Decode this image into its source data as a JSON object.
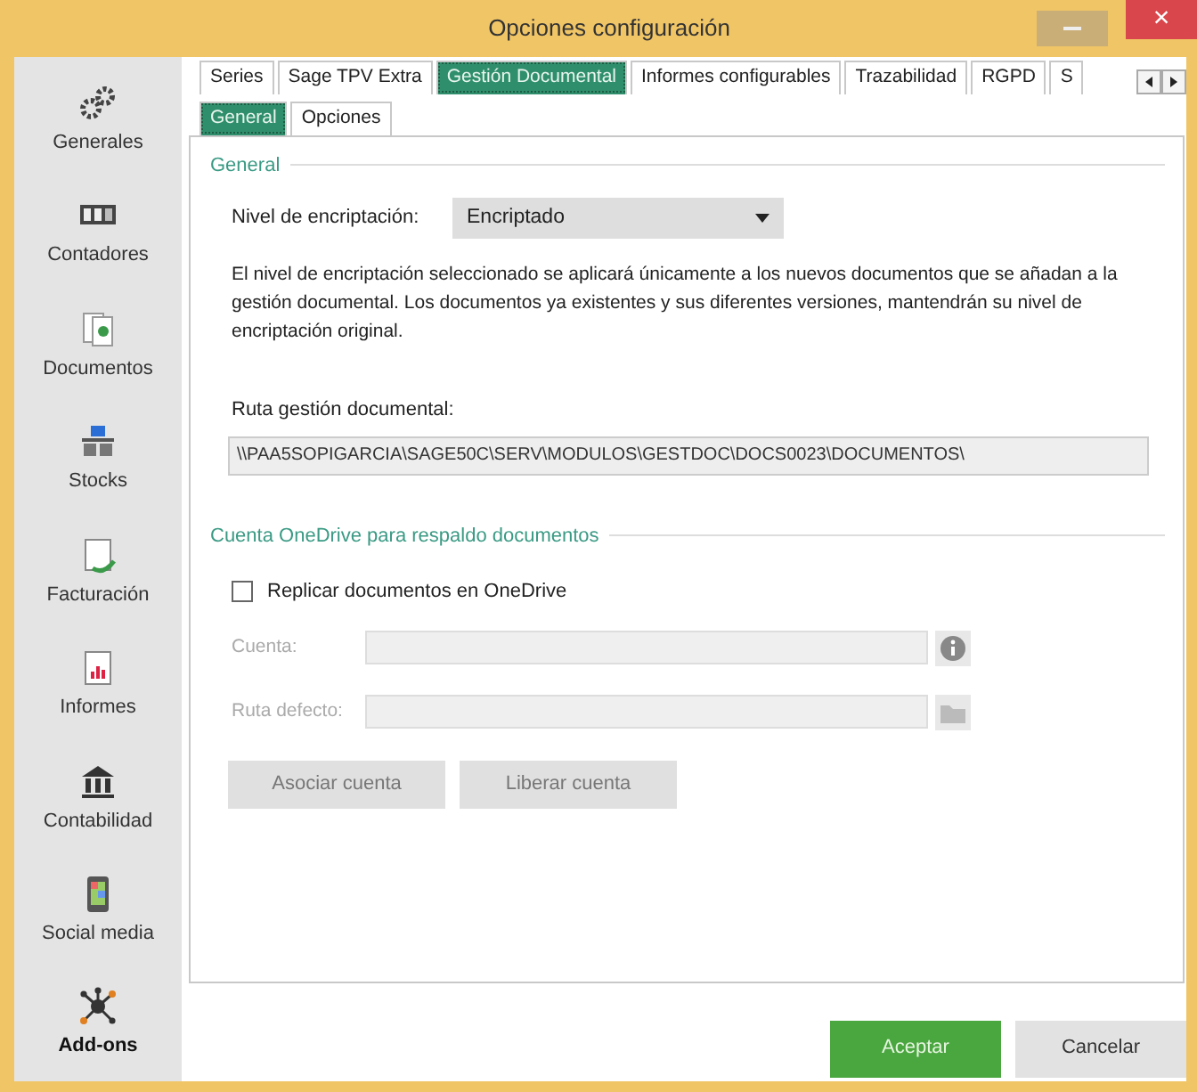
{
  "window": {
    "title": "Opciones configuración",
    "close": "×"
  },
  "sidebar": {
    "items": [
      {
        "kind": "gears",
        "label": "Generales",
        "selected": false
      },
      {
        "kind": "counter",
        "label": "Contadores",
        "selected": false
      },
      {
        "kind": "documents",
        "label": "Documentos",
        "selected": false
      },
      {
        "kind": "stocks",
        "label": "Stocks",
        "selected": false
      },
      {
        "kind": "invoice",
        "label": "Facturación",
        "selected": false
      },
      {
        "kind": "report",
        "label": "Informes",
        "selected": false
      },
      {
        "kind": "bank",
        "label": "Contabilidad",
        "selected": false
      },
      {
        "kind": "phone",
        "label": "Social media",
        "selected": false
      },
      {
        "kind": "network",
        "label": "Add-ons",
        "selected": true
      }
    ]
  },
  "tabs": [
    {
      "label": "Series",
      "selected": false
    },
    {
      "label": "Sage TPV Extra",
      "selected": false
    },
    {
      "label": "Gestión Documental",
      "selected": true
    },
    {
      "label": "Informes configurables",
      "selected": false
    },
    {
      "label": "Trazabilidad",
      "selected": false
    },
    {
      "label": "RGPD",
      "selected": false
    },
    {
      "label": "S",
      "selected": false
    }
  ],
  "subtabs": [
    {
      "label": "General",
      "selected": true
    },
    {
      "label": "Opciones",
      "selected": false
    }
  ],
  "general": {
    "heading": "General",
    "encryption_label": "Nivel de encriptación:",
    "encryption_value": "Encriptado",
    "note": "El nivel de encriptación seleccionado se aplicará únicamente a los nuevos documentos que se añadan a la gestión documental. Los documentos ya existentes y sus diferentes versiones, mantendrán su nivel de encriptación original.",
    "path_label": "Ruta gestión documental:",
    "path_value": "\\\\PAA5SOPIGARCIA\\SAGE50C\\SERV\\MODULOS\\GESTDOC\\DOCS0023\\DOCUMENTOS\\"
  },
  "onedrive": {
    "heading": "Cuenta OneDrive para respaldo documentos",
    "replicate": {
      "label": "Replicar documentos en OneDrive",
      "checked": false
    },
    "fields": [
      {
        "kind": "info",
        "label": "Cuenta:",
        "disabled": true
      },
      {
        "kind": "folder",
        "label": "Ruta defecto:",
        "disabled": true
      }
    ],
    "buttons": [
      {
        "label": "Asociar cuenta",
        "disabled": true
      },
      {
        "label": "Liberar cuenta",
        "disabled": true
      }
    ]
  },
  "footer": {
    "buttons": [
      {
        "kind": "primary",
        "label": "Aceptar"
      },
      {
        "kind": "secondary",
        "label": "Cancelar"
      }
    ]
  }
}
